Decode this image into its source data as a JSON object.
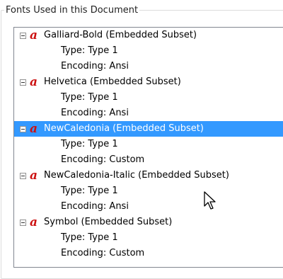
{
  "group": {
    "title": "Fonts Used in this Document"
  },
  "fonts": [
    {
      "name": "Galliard-Bold (Embedded Subset)",
      "type": "Type: Type 1",
      "encoding": "Encoding: Ansi",
      "selected": false
    },
    {
      "name": "Helvetica (Embedded Subset)",
      "type": "Type: Type 1",
      "encoding": "Encoding: Ansi",
      "selected": false
    },
    {
      "name": "NewCaledonia (Embedded Subset)",
      "type": "Type: Type 1",
      "encoding": "Encoding: Custom",
      "selected": true
    },
    {
      "name": "NewCaledonia-Italic (Embedded Subset)",
      "type": "Type: Type 1",
      "encoding": "Encoding: Ansi",
      "selected": false
    },
    {
      "name": "Symbol (Embedded Subset)",
      "type": "Type: Type 1",
      "encoding": "Encoding: Custom",
      "selected": false
    }
  ],
  "icons": {
    "font_icon": "font-icon",
    "toggle_icon": "collapse-icon"
  },
  "colors": {
    "selection": "#3399ff",
    "font_icon": "#cc1111"
  }
}
